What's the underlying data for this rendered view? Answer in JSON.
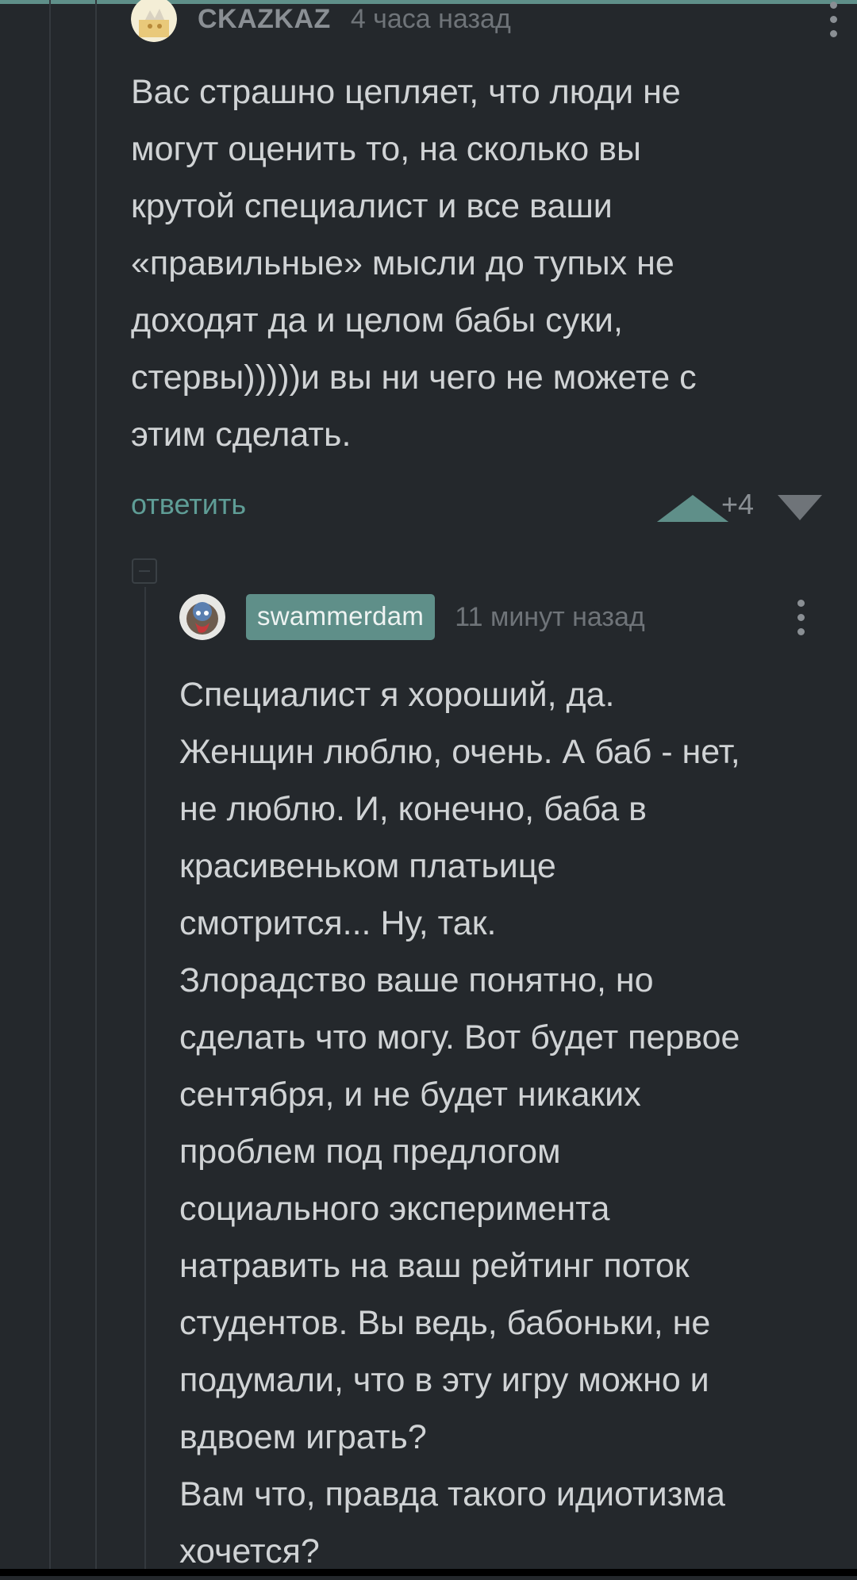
{
  "comment1": {
    "username": "CKAZKAZ",
    "time": "4 часа назад",
    "lines": [
      "Вас страшно цепляет, что люди не",
      "могут оценить то, на сколько вы",
      "крутой специалист и все ваши",
      "«правильные» мысли до тупых не",
      "доходят да и целом бабы суки,",
      "стервы)))))и вы ни чего не можете с",
      "этим сделать."
    ],
    "reply_label": "ответить",
    "rating": "+4"
  },
  "comment2": {
    "username": "swammerdam",
    "time": "11 минут назад",
    "lines": [
      "Специалист я хороший, да.",
      "Женщин люблю, очень. А баб - нет,",
      "не люблю. И, конечно, баба в",
      "красивеньком платьице",
      "смотрится... Ну, так.",
      "Злорадство ваше понятно, но",
      "сделать что могу. Вот будет первое",
      "сентября, и не будет никаких",
      "проблем под предлогом",
      "социального эксперимента",
      "натравить на ваш рейтинг поток",
      "студентов. Вы ведь, бабоньки, не",
      "подумали, что в эту игру можно и",
      "вдвоем играть?",
      "Вам что, правда такого идиотизма",
      "хочется?"
    ]
  },
  "icons": {
    "upvote": "triangle-up-icon",
    "downvote": "triangle-down-icon",
    "menu": "more-vertical-icon",
    "collapse": "collapse-icon"
  },
  "colors": {
    "background": "#24282c",
    "accent": "#5f8f89",
    "text": "#d0d3d5",
    "muted": "#6f7479"
  }
}
